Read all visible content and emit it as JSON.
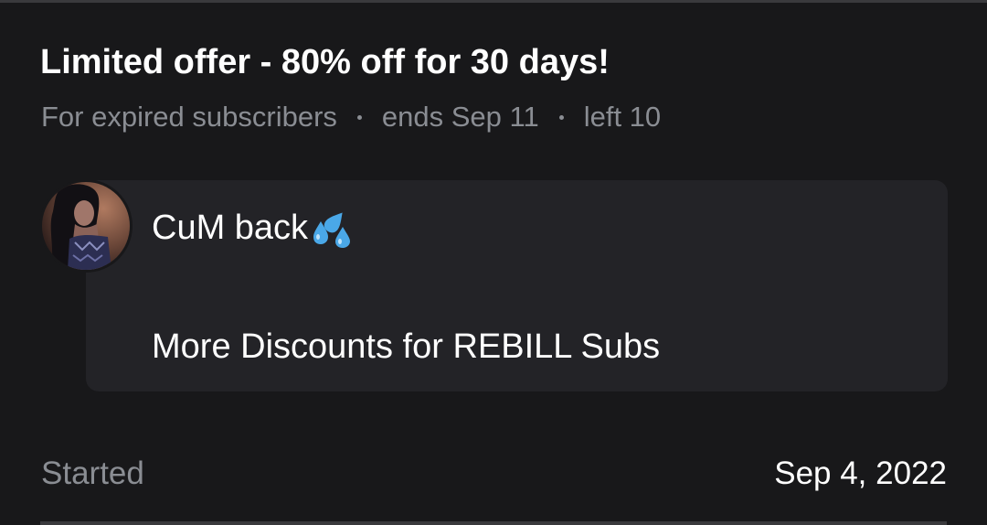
{
  "offer": {
    "title": "Limited offer - 80% off for 30 days!",
    "audience": "For expired subscribers",
    "ends": "ends Sep 11",
    "left": "left 10"
  },
  "message": {
    "line1": "CuM back",
    "emoji_icon": "sweat-droplets-icon",
    "line2": "More Discounts for REBILL Subs"
  },
  "footer": {
    "started_label": "Started",
    "started_date": "Sep 4, 2022"
  },
  "colors": {
    "background": "#18181a",
    "bubble": "#232327",
    "muted_text": "#8a8d93",
    "primary_text": "#ffffff",
    "emoji": "#4aa8e8"
  }
}
